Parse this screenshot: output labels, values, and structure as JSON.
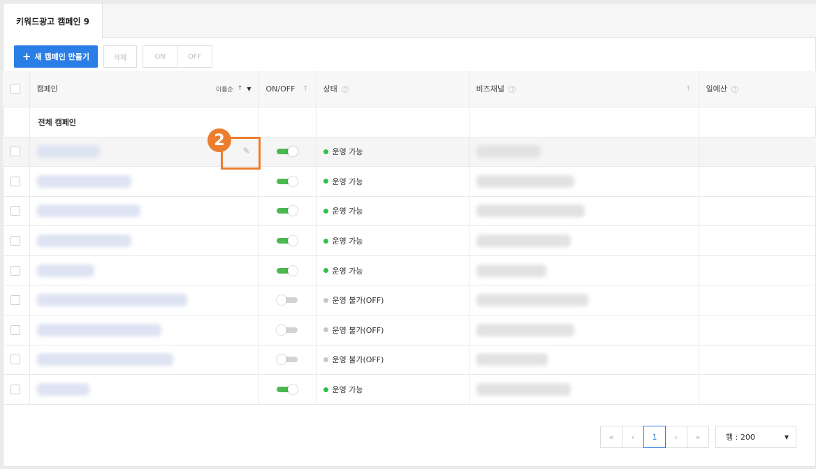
{
  "tabs": [
    {
      "label": "키워드광고 캠페인 9"
    }
  ],
  "toolbar": {
    "new_campaign_label": "새 캠페인 만들기",
    "delete_label": "삭제",
    "on_label": "ON",
    "off_label": "OFF"
  },
  "table": {
    "columns": {
      "campaign": "캠페인",
      "sort_label": "이름순",
      "onoff": "ON/OFF",
      "status": "상태",
      "bizchannel": "비즈채널",
      "budget": "일예산"
    },
    "total_row_label": "전체 캠페인",
    "rows": [
      {
        "enabled": true,
        "status": "운영 가능",
        "status_color": "#2fbf4a",
        "highlighted": true
      },
      {
        "enabled": true,
        "status": "운영 가능",
        "status_color": "#2fbf4a"
      },
      {
        "enabled": true,
        "status": "운영 가능",
        "status_color": "#2fbf4a"
      },
      {
        "enabled": true,
        "status": "운영 가능",
        "status_color": "#2fbf4a"
      },
      {
        "enabled": true,
        "status": "운영 가능",
        "status_color": "#2fbf4a"
      },
      {
        "enabled": false,
        "status": "운영 불가(OFF)",
        "status_color": "#c8c8c8"
      },
      {
        "enabled": false,
        "status": "운영 불가(OFF)",
        "status_color": "#c8c8c8"
      },
      {
        "enabled": false,
        "status": "운영 불가(OFF)",
        "status_color": "#c8c8c8"
      },
      {
        "enabled": true,
        "status": "운영 가능",
        "status_color": "#2fbf4a"
      }
    ]
  },
  "annotation": {
    "step_number": "2",
    "color": "#ec7d2f"
  },
  "pagination": {
    "first_label": "«",
    "prev_label": "‹",
    "current_page": "1",
    "next_label": "›",
    "last_label": "»",
    "rows_label": "행 : 200"
  },
  "colors": {
    "accent": "#2b7ee6",
    "toggle_on": "#4cb851"
  }
}
